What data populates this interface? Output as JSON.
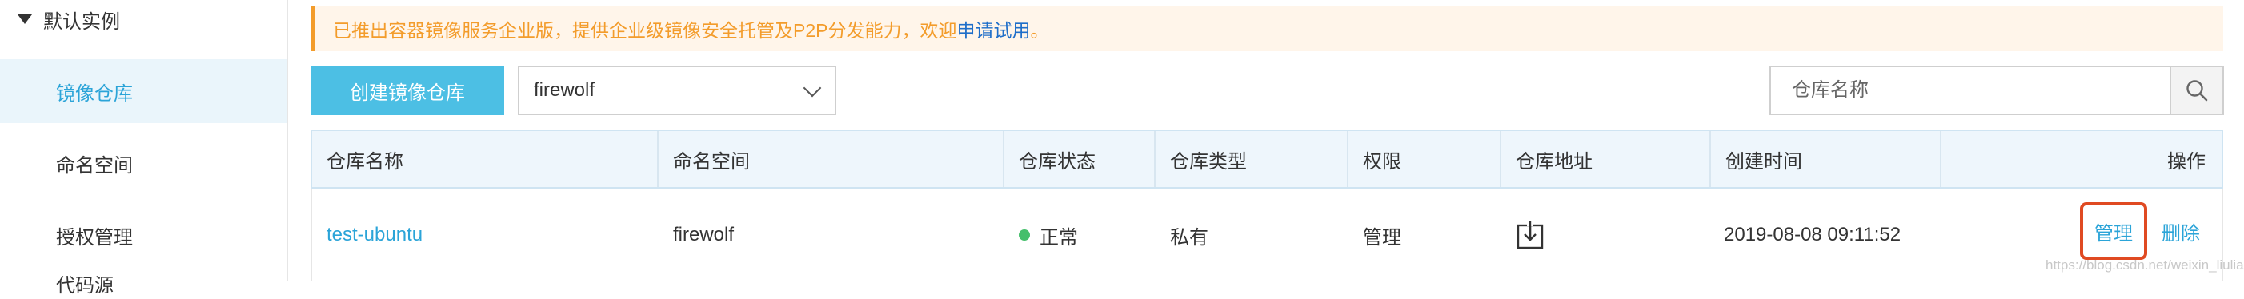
{
  "sidebar": {
    "group_label": "默认实例",
    "items": [
      {
        "label": "镜像仓库",
        "active": true
      },
      {
        "label": "命名空间",
        "active": false
      },
      {
        "label": "授权管理",
        "active": false
      },
      {
        "label": "代码源",
        "active": false
      }
    ]
  },
  "banner": {
    "text": "已推出容器镜像服务企业版，提供企业级镜像安全托管及P2P分发能力，欢迎",
    "link_text": "申请试用",
    "suffix": "。"
  },
  "toolbar": {
    "create_label": "创建镜像仓库",
    "namespace_value": "firewolf",
    "search_placeholder": "仓库名称"
  },
  "table": {
    "headers": [
      "仓库名称",
      "命名空间",
      "仓库状态",
      "仓库类型",
      "权限",
      "仓库地址",
      "创建时间",
      "操作"
    ],
    "rows": [
      {
        "name": "test-ubuntu",
        "namespace": "firewolf",
        "status": "正常",
        "type": "私有",
        "permission": "管理",
        "created": "2019-08-08 09:11:52",
        "actions": {
          "manage": "管理",
          "delete": "删除"
        }
      }
    ]
  },
  "watermark": "https://blog.csdn.net/weixin_liuliang",
  "colors": {
    "accent": "#4cbfe4",
    "link": "#2ba4d8",
    "status_ok": "#45bf6b",
    "banner_text": "#f39c2b",
    "highlight_box": "#e04a22"
  }
}
